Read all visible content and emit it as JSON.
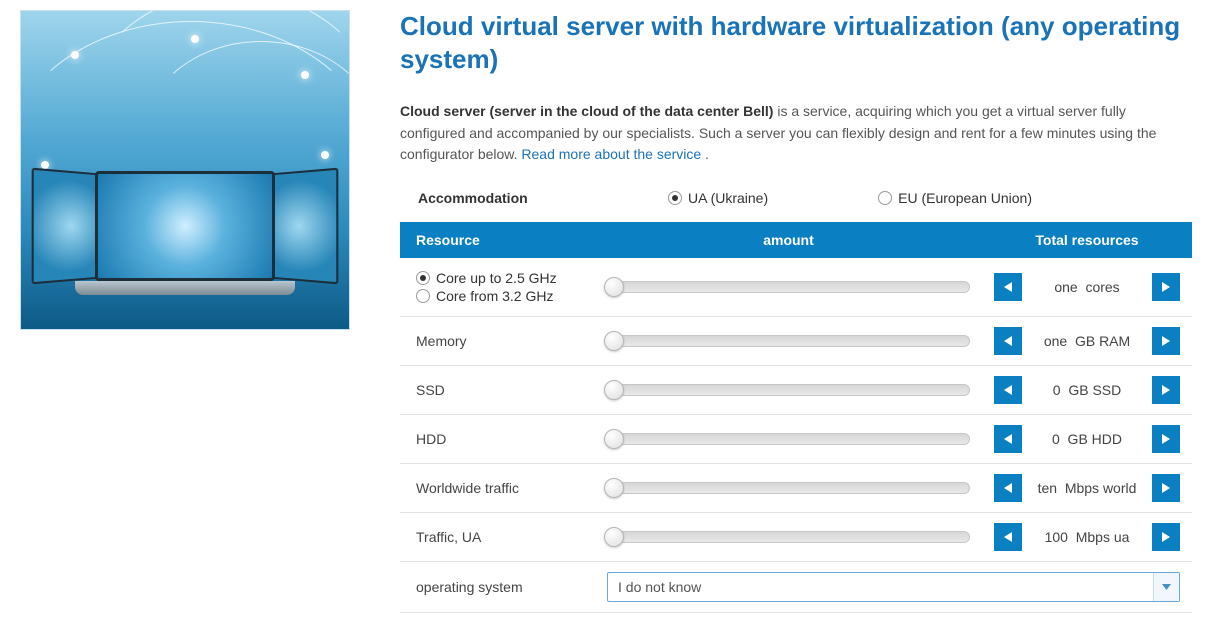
{
  "title": "Cloud virtual server with hardware virtualization (any operating system)",
  "description": {
    "bold": "Cloud server (server in the cloud of the data center Bell)",
    "rest": " is a service, acquiring which you get a virtual server fully configured and accompanied by our specialists. Such a server you can flexibly design and rent for a few minutes using the configurator below. ",
    "link": "Read more about the service",
    "tail": " ."
  },
  "accommodation": {
    "label": "Accommodation",
    "options": [
      {
        "label": "UA (Ukraine)",
        "checked": true
      },
      {
        "label": "EU (European Union)",
        "checked": false
      }
    ]
  },
  "table": {
    "headers": {
      "resource": "Resource",
      "amount": "amount",
      "total": "Total resources"
    },
    "rows": [
      {
        "type": "radio",
        "radios": [
          {
            "label": "Core up to 2.5 GHz",
            "checked": true
          },
          {
            "label": "Core from 3.2 GHz",
            "checked": false
          }
        ],
        "total_value": "one",
        "total_unit": "cores"
      },
      {
        "type": "plain",
        "label": "Memory",
        "total_value": "one",
        "total_unit": "GB RAM"
      },
      {
        "type": "plain",
        "label": "SSD",
        "total_value": "0",
        "total_unit": "GB SSD"
      },
      {
        "type": "plain",
        "label": "HDD",
        "total_value": "0",
        "total_unit": "GB HDD"
      },
      {
        "type": "plain",
        "label": "Worldwide traffic",
        "total_value": "ten",
        "total_unit": "Mbps world"
      },
      {
        "type": "plain",
        "label": "Traffic, UA",
        "total_value": "100",
        "total_unit": "Mbps ua"
      }
    ],
    "os_row": {
      "label": "operating system",
      "selected": "I do not know"
    }
  }
}
